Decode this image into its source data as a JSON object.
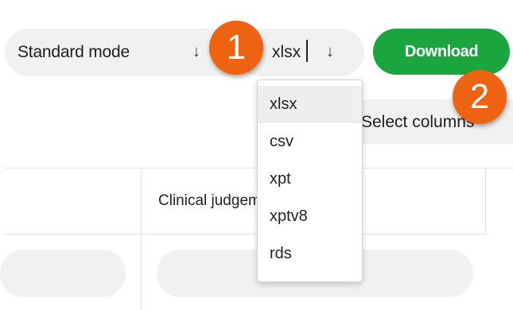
{
  "toolbar": {
    "mode_label": "Standard mode",
    "mode_arrow": "↓",
    "format_value": "xlsx",
    "format_arrow": "↓",
    "download_label": "Download",
    "select_columns_label": "Select columns"
  },
  "format_dropdown": {
    "selected": "xlsx",
    "options": [
      "xlsx",
      "csv",
      "xpt",
      "xptv8",
      "rds"
    ]
  },
  "table": {
    "column_header": "Clinical judgement"
  },
  "annotations": {
    "step_1": "1",
    "step_2": "2"
  },
  "colors": {
    "download_button": "#1ba53e",
    "step_badge": "#ee6312",
    "control_background": "#f1f1f1"
  }
}
